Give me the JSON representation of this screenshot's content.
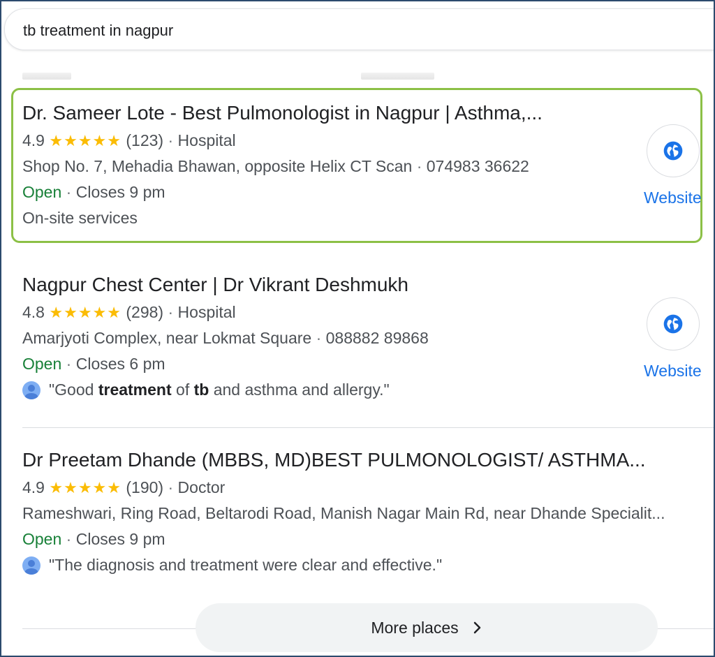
{
  "search": {
    "query": "tb treatment in nagpur"
  },
  "listings": [
    {
      "title": "Dr. Sameer Lote - Best Pulmonologist in Nagpur | Asthma,...",
      "rating": "4.9",
      "stars": "★★★★★",
      "reviews": "(123)",
      "category": "Hospital",
      "address": "Shop No. 7, Mehadia Bhawan, opposite Helix CT Scan",
      "phone": "074983 36622",
      "status": "Open",
      "hours": "Closes 9 pm",
      "extra": "On-site services",
      "website_label": "Website"
    },
    {
      "title": "Nagpur Chest Center | Dr Vikrant Deshmukh",
      "rating": "4.8",
      "stars": "★★★★★",
      "reviews": "(298)",
      "category": "Hospital",
      "address": "Amarjyoti Complex, near Lokmat Square",
      "phone": "088882 89868",
      "status": "Open",
      "hours": "Closes 6 pm",
      "review_parts": [
        "\"Good ",
        "treatment",
        " of ",
        "tb",
        " and asthma and allergy.\""
      ],
      "website_label": "Website"
    },
    {
      "title": "Dr Preetam Dhande (MBBS, MD)BEST PULMONOLOGIST/ ASTHMA...",
      "rating": "4.9",
      "stars": "★★★★★",
      "reviews": "(190)",
      "category": "Doctor",
      "address": "Rameshwari, Ring Road, Beltarodi Road, Manish Nagar Main Rd, near Dhande Specialit...",
      "status": "Open",
      "hours": "Closes 9 pm",
      "review": "\"The diagnosis and treatment were clear and effective.\""
    }
  ],
  "separator": "·",
  "more_places_label": "More places",
  "colors": {
    "open": "#188038",
    "link": "#1a73e8",
    "star": "#fbbc04",
    "highlight": "#8cc046"
  }
}
